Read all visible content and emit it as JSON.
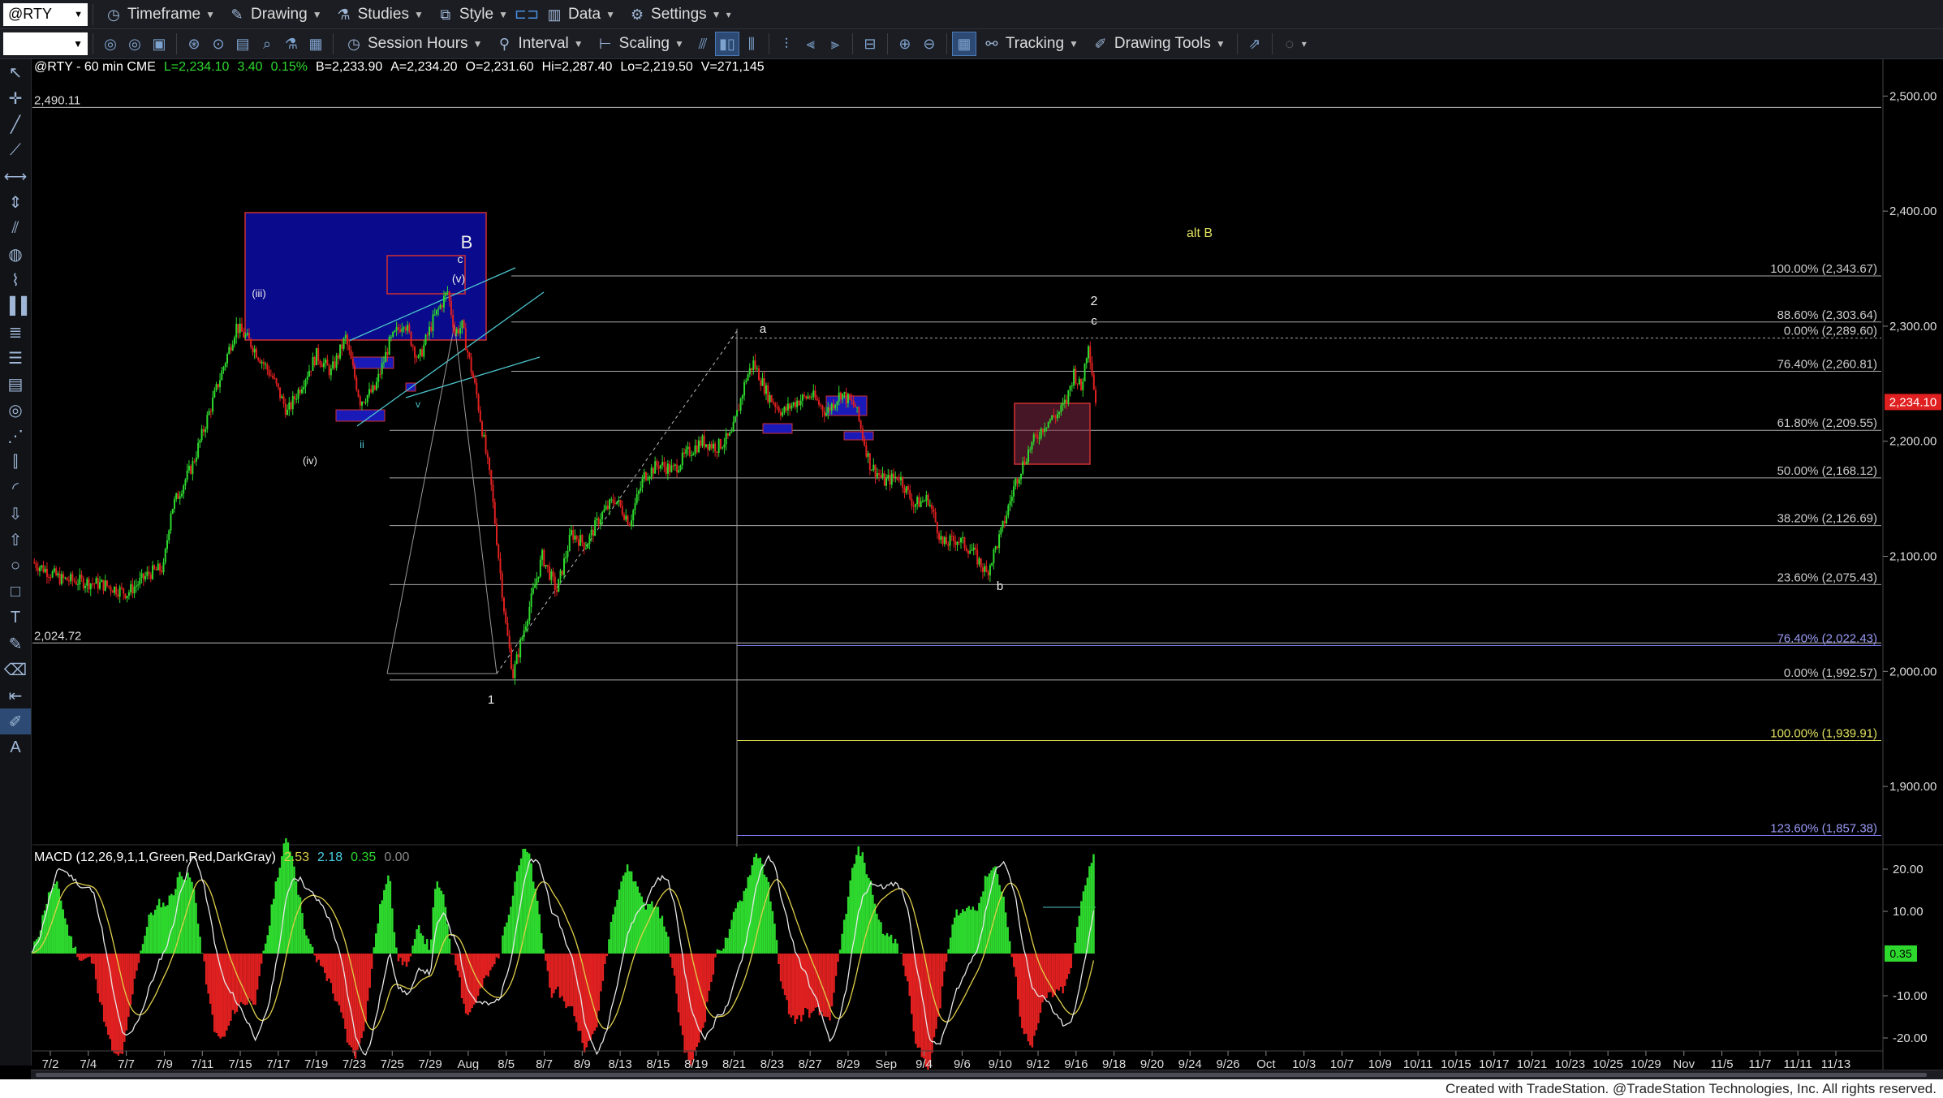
{
  "toolbar1": {
    "symbol": "@RTY",
    "items": [
      "Timeframe",
      "Drawing",
      "Studies",
      "Style",
      "Data",
      "Settings"
    ]
  },
  "toolbar2": {
    "session_hours": "Session Hours",
    "interval": "Interval",
    "scaling": "Scaling",
    "tracking": "Tracking",
    "drawing_tools": "Drawing Tools"
  },
  "chart_header": {
    "symbol_info": "@RTY - 60 min  CME",
    "last": "L=2,234.10",
    "change": "3.40",
    "change_pct": "0.15%",
    "bid": "B=2,233.90",
    "ask": "A=2,234.20",
    "open": "O=2,231.60",
    "high": "Hi=2,287.40",
    "low": "Lo=2,219.50",
    "volume": "V=271,145"
  },
  "colors": {
    "background": "#000000",
    "up_candle": "#2ed92e",
    "down_candle": "#e02020",
    "level_line": "#c8c8c8",
    "price_tag": "#e02020",
    "macd_line": "#e8e8e8",
    "signal_line": "#e0d04a"
  },
  "chart_data": {
    "type": "line",
    "price_axis": {
      "ylim": [
        1850,
        2520
      ],
      "ticks": [
        1900,
        2000,
        2100,
        2200,
        2300,
        2400,
        2500
      ],
      "tick_labels": [
        "1,900.00",
        "2,000.00",
        "2,100.00",
        "2,200.00",
        "2,300.00",
        "2,400.00",
        "2,500.00"
      ],
      "current_price": 2234.1,
      "current_price_label": "2,234.10"
    },
    "date_axis": {
      "labels": [
        "7/2",
        "7/4",
        "7/7",
        "7/9",
        "7/11",
        "7/15",
        "7/17",
        "7/19",
        "7/23",
        "7/25",
        "7/29",
        "Aug",
        "8/5",
        "8/7",
        "8/9",
        "8/13",
        "8/15",
        "8/19",
        "8/21",
        "8/23",
        "8/27",
        "8/29",
        "Sep",
        "9/4",
        "9/6",
        "9/10",
        "9/12",
        "9/16",
        "9/18",
        "9/20",
        "9/24",
        "9/26",
        "Oct",
        "10/3",
        "10/7",
        "10/9",
        "10/11",
        "10/15",
        "10/17",
        "10/21",
        "10/23",
        "10/25",
        "10/29",
        "Nov",
        "11/5",
        "11/7",
        "11/11",
        "11/13"
      ]
    },
    "price_path": [
      [
        0,
        2095
      ],
      [
        4,
        2080
      ],
      [
        7,
        2078
      ],
      [
        10,
        2075
      ],
      [
        13,
        2068
      ],
      [
        16,
        2085
      ],
      [
        18,
        2090
      ],
      [
        19,
        2140
      ],
      [
        22,
        2180
      ],
      [
        25,
        2240
      ],
      [
        28,
        2300
      ],
      [
        30,
        2285
      ],
      [
        33,
        2255
      ],
      [
        35,
        2225
      ],
      [
        37,
        2250
      ],
      [
        39,
        2275
      ],
      [
        41,
        2260
      ],
      [
        43,
        2290
      ],
      [
        45,
        2235
      ],
      [
        47,
        2245
      ],
      [
        49,
        2285
      ],
      [
        51,
        2305
      ],
      [
        53,
        2270
      ],
      [
        55,
        2305
      ],
      [
        57,
        2330
      ],
      [
        58,
        2295
      ],
      [
        59,
        2300
      ],
      [
        61,
        2240
      ],
      [
        63,
        2160
      ],
      [
        65,
        2040
      ],
      [
        66,
        1997
      ],
      [
        68,
        2050
      ],
      [
        70,
        2100
      ],
      [
        72,
        2070
      ],
      [
        74,
        2120
      ],
      [
        76,
        2110
      ],
      [
        78,
        2135
      ],
      [
        80,
        2150
      ],
      [
        82,
        2130
      ],
      [
        84,
        2170
      ],
      [
        86,
        2180
      ],
      [
        88,
        2175
      ],
      [
        90,
        2190
      ],
      [
        92,
        2200
      ],
      [
        94,
        2195
      ],
      [
        96,
        2205
      ],
      [
        98,
        2255
      ],
      [
        99,
        2268
      ],
      [
        101,
        2240
      ],
      [
        103,
        2225
      ],
      [
        105,
        2235
      ],
      [
        107,
        2240
      ],
      [
        109,
        2225
      ],
      [
        111,
        2242
      ],
      [
        113,
        2230
      ],
      [
        115,
        2180
      ],
      [
        117,
        2165
      ],
      [
        119,
        2170
      ],
      [
        121,
        2145
      ],
      [
        123,
        2150
      ],
      [
        125,
        2110
      ],
      [
        127,
        2115
      ],
      [
        129,
        2105
      ],
      [
        131,
        2085
      ],
      [
        133,
        2120
      ],
      [
        135,
        2165
      ],
      [
        137,
        2195
      ],
      [
        139,
        2215
      ],
      [
        141,
        2225
      ],
      [
        142,
        2235
      ],
      [
        143,
        2260
      ],
      [
        144,
        2245
      ],
      [
        145,
        2287
      ],
      [
        146,
        2234
      ]
    ],
    "fib_levels": [
      {
        "label": "100.00% (2,343.67)",
        "value": 2343.67
      },
      {
        "label": "88.60% (2,303.64)",
        "value": 2303.64
      },
      {
        "label": "0.00% (2,289.60)",
        "value": 2289.6
      },
      {
        "label": "76.40% (2,260.81)",
        "value": 2260.81
      },
      {
        "label": "61.80% (2,209.55)",
        "value": 2209.55
      },
      {
        "label": "50.00% (2,168.12)",
        "value": 2168.12
      },
      {
        "label": "38.20% (2,126.69)",
        "value": 2126.69
      },
      {
        "label": "23.60% (2,075.43)",
        "value": 2075.43
      },
      {
        "label": "76.40% (2,022.43)",
        "value": 2022.43
      },
      {
        "label": "0.00% (1,992.57)",
        "value": 1992.57
      },
      {
        "label": "100.00% (1,939.91)",
        "value": 1939.91
      },
      {
        "label": "123.60% (1,857.38)",
        "value": 1857.38
      }
    ],
    "horizontal_levels": [
      {
        "label": "2,490.11",
        "value": 2490.11
      },
      {
        "label": "2,024.72",
        "value": 2024.72
      }
    ],
    "wave_labels": [
      "B",
      "c",
      "(v)",
      "(iii)",
      "(iv)",
      "ii",
      "v",
      "1",
      "a",
      "b",
      "c",
      "2",
      "alt B"
    ],
    "macd": {
      "title": "MACD (12,26,9,1,1,Green,Red,DarkGray)",
      "values": [
        "2.53",
        "2.18",
        "0.35",
        "0.00"
      ],
      "ylim": [
        -25,
        25
      ],
      "ticks": [
        20,
        10,
        -10,
        -20
      ],
      "tick_labels": [
        "20.00",
        "10.00",
        "-10.00",
        "-20.00"
      ],
      "current_label": "0.35"
    }
  },
  "footer": "Created with TradeStation. @TradeStation Technologies, Inc. All rights reserved."
}
